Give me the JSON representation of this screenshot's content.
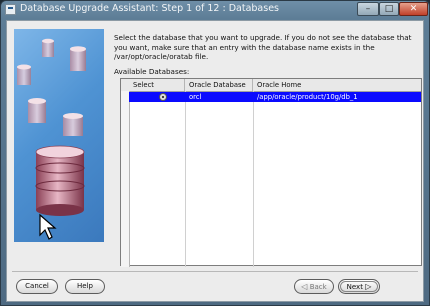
{
  "window": {
    "title": "Database Upgrade Assistant: Step 1 of 12 : Databases",
    "controls": {
      "minimize": "–",
      "maximize": "□",
      "close": "✕"
    }
  },
  "main": {
    "instructions": "Select the database that you want to upgrade. If you do not see the database that you want, make sure that an entry with the database name exists in the /var/opt/oracle/oratab file.",
    "available_label": "Available Databases:",
    "table": {
      "columns": [
        "Select",
        "Oracle Database",
        "Oracle Home"
      ],
      "rows": [
        {
          "selected": true,
          "database": "orcl",
          "home": "/app/oracle/product/10g/db_1"
        }
      ]
    }
  },
  "footer": {
    "cancel": "Cancel",
    "help": "Help",
    "back_arrow": "◁",
    "back": "Back",
    "next": "Next",
    "next_arrow": "▷"
  },
  "colors": {
    "selection": "#0a0aff",
    "side_panel": "#4f93d3"
  }
}
